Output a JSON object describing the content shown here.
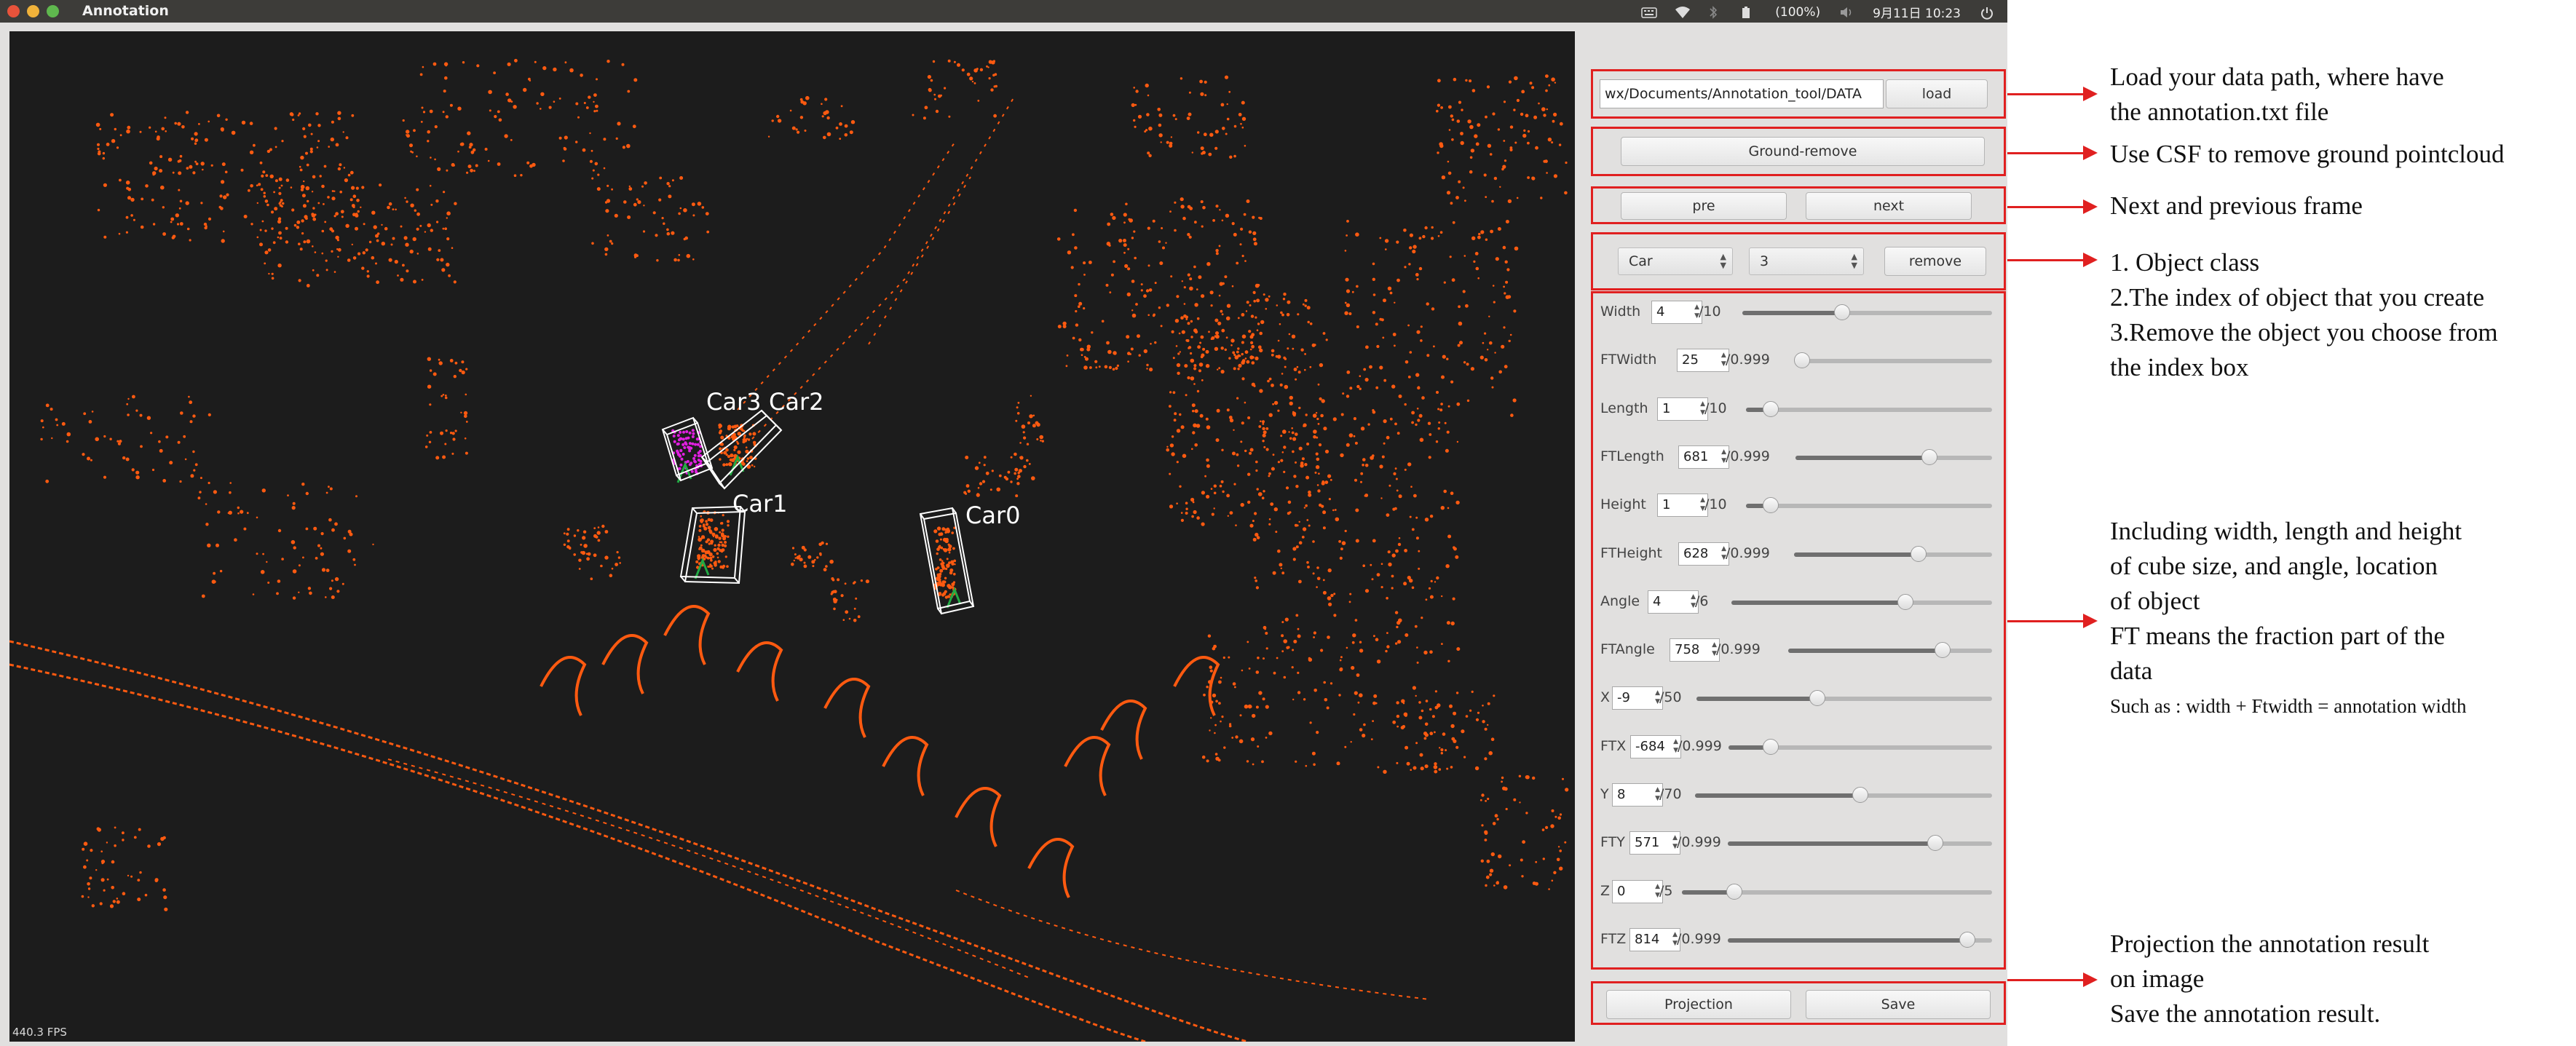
{
  "topbar": {
    "app_title": "Annotation",
    "battery": "(100%)",
    "clock": "9月11日 10:23",
    "icons": [
      "keyboard-icon",
      "wifi-icon",
      "bluetooth-icon",
      "battery-icon",
      "volume-icon",
      "power-icon"
    ]
  },
  "viewport": {
    "fps_text": "440.3 FPS",
    "point_color": "#ff5a10",
    "labels": [
      "Car3",
      "Car2",
      "Car1",
      "Car0"
    ]
  },
  "controls": {
    "path_value": "wx/Documents/Annotation_tool/DATA",
    "load_label": "load",
    "ground_remove_label": "Ground-remove",
    "pre_label": "pre",
    "next_label": "next",
    "class_value": "Car",
    "index_value": "3",
    "remove_label": "remove",
    "projection_label": "Projection",
    "save_label": "Save"
  },
  "params": [
    {
      "label": "Width",
      "value": "4",
      "max": "/10",
      "slider": 0.4
    },
    {
      "label": "FTWidth",
      "value": "25",
      "max": "/0.999",
      "slider": 0.025
    },
    {
      "label": "Length",
      "value": "1",
      "max": "/10",
      "slider": 0.1
    },
    {
      "label": "FTLength",
      "value": "681",
      "max": "/0.999",
      "slider": 0.681
    },
    {
      "label": "Height",
      "value": "1",
      "max": "/10",
      "slider": 0.1
    },
    {
      "label": "FTHeight",
      "value": "628",
      "max": "/0.999",
      "slider": 0.628
    },
    {
      "label": "Angle",
      "value": "4",
      "max": "/6",
      "slider": 0.667
    },
    {
      "label": "FTAngle",
      "value": "758",
      "max": "/0.999",
      "slider": 0.758
    },
    {
      "label": "X",
      "value": "-9",
      "max": "/50",
      "slider": 0.41
    },
    {
      "label": "FTX",
      "value": "-684",
      "max": "/0.999",
      "slider": 0.16
    },
    {
      "label": "Y",
      "value": "8",
      "max": "/70",
      "slider": 0.557
    },
    {
      "label": "FTY",
      "value": "571",
      "max": "/0.999",
      "slider": 0.786
    },
    {
      "label": "Z",
      "value": "0",
      "max": "/5",
      "slider": 0.17
    },
    {
      "label": "FTZ",
      "value": "814",
      "max": "/0.999",
      "slider": 0.907
    }
  ],
  "notes": {
    "load_1": "Load your data path, where have",
    "load_2": "the annotation.txt file",
    "ground": "Use CSF to remove ground pointcloud",
    "frame": "Next and previous frame",
    "obj_1": "1. Object class",
    "obj_2": "2.The index of object that you create",
    "obj_3": "3.Remove the object you choose from",
    "obj_4": "the index box",
    "param_1": "Including width, length and height",
    "param_2": "of cube size, and angle, location",
    "param_3": "of object",
    "param_4": "FT means the fraction part of the",
    "param_5": "data",
    "param_6": "Such as : width + Ftwidth = annotation width",
    "save_1": "Projection the annotation result",
    "save_2": "on image",
    "save_3": "Save the annotation result."
  },
  "colors": {
    "highlight_red": "#e02020",
    "bbox_white": "#ffffff",
    "car3_points": "#e020e0",
    "ground_arrow": "#22aa44"
  }
}
